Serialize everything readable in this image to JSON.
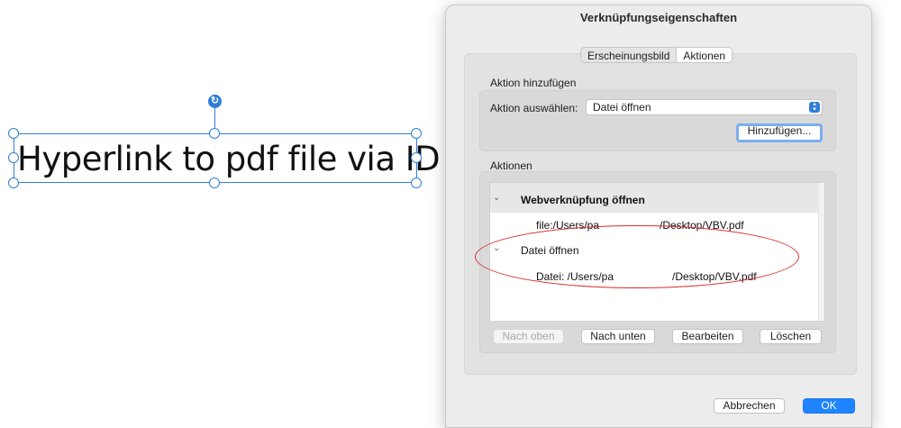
{
  "canvas": {
    "text_frame_text": "Hyperlink to pdf file via ID"
  },
  "dialog": {
    "title": "Verknüpfungseigenschaften",
    "tabs": [
      {
        "label": "Erscheinungsbild",
        "active": false
      },
      {
        "label": "Aktionen",
        "active": true
      }
    ],
    "add_action": {
      "section_label": "Aktion hinzufügen",
      "select_label": "Aktion auswählen:",
      "select_value": "Datei öffnen",
      "add_button": "Hinzufügen..."
    },
    "actions": {
      "section_label": "Aktionen",
      "items": [
        {
          "title": "Webverknüpfung öffnen",
          "detail_prefix": "file:/Users/pa",
          "detail_suffix": "/Desktop/VBV.pdf"
        },
        {
          "title": "Datei öffnen",
          "detail_prefix": "Datei: /Users/pa",
          "detail_suffix": "/Desktop/VBV.pdf"
        }
      ],
      "buttons": {
        "up": "Nach oben",
        "down": "Nach unten",
        "edit": "Bearbeiten",
        "delete": "Löschen"
      }
    },
    "footer": {
      "cancel": "Abbrechen",
      "ok": "OK"
    }
  },
  "colors": {
    "accent": "#1f84ff",
    "selection": "#2f7fd8",
    "annotation_ellipse": "#d92b2b"
  }
}
